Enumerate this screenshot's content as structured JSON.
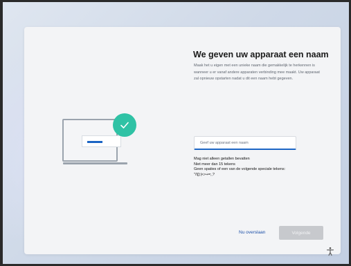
{
  "setup": {
    "title": "We geven uw apparaat een naam",
    "description": "Maak het u eigen met een unieke naam die gemakkelijk te herkennen is wanneer u er vanaf andere apparaten verbinding mee maakt. Uw apparaat zal opnieuw opstarten nadat u dit een naam hebt gegeven.",
    "input": {
      "placeholder": "Geef uw apparaat een naam",
      "value": ""
    },
    "rules": [
      "Mag niet alleen getallen bevatten",
      "Niet meer dan 15 tekens",
      "Geen spaties of een van de volgende speciale tekens:",
      "\"/\\[]:|<>+=;,?"
    ],
    "skip_label": "Nu overslaan",
    "next_label": "Volgende"
  },
  "colors": {
    "accent": "#1b65c4",
    "check": "#2fc2a5",
    "disabled_button": "#c7c9cd"
  },
  "icons": {
    "illustration": "laptop-icon",
    "badge": "checkmark-icon",
    "corner": "accessibility-icon"
  }
}
